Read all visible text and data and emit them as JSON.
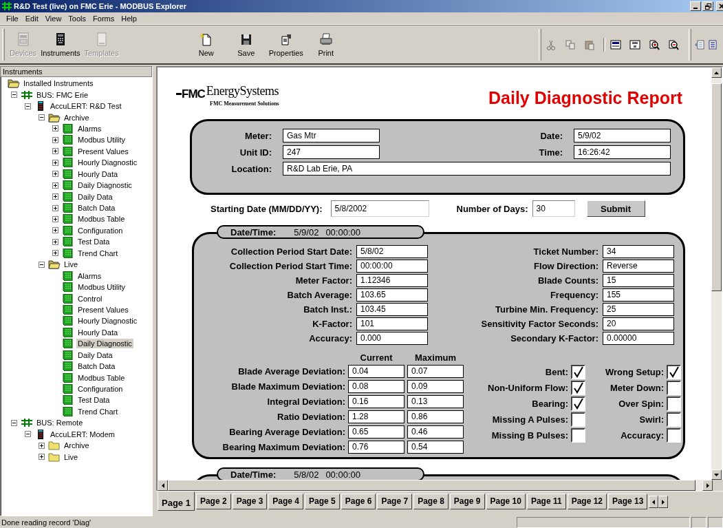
{
  "window": {
    "title": "R&D Test (live) on FMC Erie - MODBUS Explorer"
  },
  "menu": [
    "File",
    "Edit",
    "View",
    "Tools",
    "Forms",
    "Help"
  ],
  "toolbar": {
    "panes": [
      {
        "label": "Devices",
        "disabled": true
      },
      {
        "label": "Instruments",
        "disabled": false
      },
      {
        "label": "Templates",
        "disabled": true
      }
    ],
    "actions": [
      {
        "label": "New"
      },
      {
        "label": "Save"
      },
      {
        "label": "Properties"
      },
      {
        "label": "Print"
      }
    ],
    "edit_tools": [
      {
        "disabled": true
      },
      {
        "disabled": true
      },
      {
        "disabled": true
      },
      {
        "disabled": false
      },
      {
        "disabled": false
      },
      {
        "disabled": false
      },
      {
        "disabled": false
      }
    ]
  },
  "sidebar": {
    "title": "Instruments",
    "tree": [
      {
        "label": "Installed Instruments",
        "kind": "folder",
        "expanded": true,
        "selected": false,
        "children": [
          {
            "label": "BUS: FMC Erie",
            "kind": "bus",
            "expanded": true,
            "selected": false,
            "children": [
              {
                "label": "AccuLERT: R&D Test",
                "kind": "device",
                "expanded": true,
                "selected": false,
                "children": [
                  {
                    "label": "Archive",
                    "kind": "folder",
                    "expanded": true,
                    "selected": false,
                    "children": [
                      {
                        "label": "Alarms",
                        "kind": "form",
                        "expanded": false,
                        "selected": false
                      },
                      {
                        "label": "Modbus Utility",
                        "kind": "form",
                        "expanded": false,
                        "selected": false
                      },
                      {
                        "label": "Present Values",
                        "kind": "form",
                        "expanded": false,
                        "selected": false
                      },
                      {
                        "label": "Hourly Diagnostic",
                        "kind": "form",
                        "expanded": false,
                        "selected": false
                      },
                      {
                        "label": "Hourly Data",
                        "kind": "form",
                        "expanded": false,
                        "selected": false
                      },
                      {
                        "label": "Daily Diagnostic",
                        "kind": "form",
                        "expanded": false,
                        "selected": false
                      },
                      {
                        "label": "Daily Data",
                        "kind": "form",
                        "expanded": false,
                        "selected": false
                      },
                      {
                        "label": "Batch Data",
                        "kind": "form",
                        "expanded": false,
                        "selected": false
                      },
                      {
                        "label": "Modbus Table",
                        "kind": "form",
                        "expanded": false,
                        "selected": false
                      },
                      {
                        "label": "Configuration",
                        "kind": "form",
                        "expanded": false,
                        "selected": false
                      },
                      {
                        "label": "Test Data",
                        "kind": "form",
                        "expanded": false,
                        "selected": false
                      },
                      {
                        "label": "Trend Chart",
                        "kind": "form",
                        "expanded": false,
                        "selected": false
                      }
                    ]
                  },
                  {
                    "label": "Live",
                    "kind": "folder",
                    "expanded": true,
                    "selected": false,
                    "children": [
                      {
                        "label": "Alarms",
                        "kind": "form",
                        "selected": false
                      },
                      {
                        "label": "Modbus Utility",
                        "kind": "form",
                        "selected": false
                      },
                      {
                        "label": "Control",
                        "kind": "form",
                        "selected": false
                      },
                      {
                        "label": "Present Values",
                        "kind": "form",
                        "selected": false
                      },
                      {
                        "label": "Hourly Diagnostic",
                        "kind": "form",
                        "selected": false
                      },
                      {
                        "label": "Hourly Data",
                        "kind": "form",
                        "selected": false
                      },
                      {
                        "label": "Daily Diagnostic",
                        "kind": "form",
                        "selected": true
                      },
                      {
                        "label": "Daily Data",
                        "kind": "form",
                        "selected": false
                      },
                      {
                        "label": "Batch Data",
                        "kind": "form",
                        "selected": false
                      },
                      {
                        "label": "Modbus Table",
                        "kind": "form",
                        "selected": false
                      },
                      {
                        "label": "Configuration",
                        "kind": "form",
                        "selected": false
                      },
                      {
                        "label": "Test Data",
                        "kind": "form",
                        "selected": false
                      },
                      {
                        "label": "Trend Chart",
                        "kind": "form",
                        "selected": false
                      }
                    ]
                  }
                ]
              }
            ]
          },
          {
            "label": "BUS: Remote",
            "kind": "bus",
            "expanded": true,
            "selected": false,
            "children": [
              {
                "label": "AccuLERT: Modem",
                "kind": "device",
                "expanded": true,
                "selected": false,
                "children": [
                  {
                    "label": "Archive",
                    "kind": "folder",
                    "expanded": false,
                    "selected": false
                  },
                  {
                    "label": "Live",
                    "kind": "folder",
                    "expanded": false,
                    "selected": false
                  }
                ]
              }
            ]
          }
        ]
      }
    ]
  },
  "report": {
    "logo": {
      "brand": "FMC",
      "name": "EnergySystems",
      "sub": "FMC Measurement Solutions"
    },
    "title": "Daily Diagnostic Report",
    "info": [
      {
        "label": "Meter:",
        "value": "Gas Mtr",
        "kind": "short"
      },
      {
        "label": "Date:",
        "value": "5/9/02",
        "kind": "short"
      },
      {
        "label": "Unit ID:",
        "value": "247",
        "kind": "short"
      },
      {
        "label": "Time:",
        "value": "16:26:42",
        "kind": "short"
      },
      {
        "label": "Location:",
        "value": "R&D Lab Erie, PA",
        "kind": "wide"
      }
    ],
    "query": {
      "start_label": "Starting Date (MM/DD/YY):",
      "start_value": "5/8/2002",
      "days_label": "Number of Days:",
      "days_value": "30",
      "submit": "Submit"
    },
    "records": [
      {
        "date_label": "Date/Time:",
        "date": "5/9/02",
        "time": "00:00:00",
        "fields_left": [
          {
            "label": "Collection Period Start Date:",
            "value": "5/8/02"
          },
          {
            "label": "Collection Period Start Time:",
            "value": "00:00:00"
          },
          {
            "label": "Meter Factor:",
            "value": "1.12346"
          },
          {
            "label": "Batch Average:",
            "value": "103.65"
          },
          {
            "label": "Batch Inst.:",
            "value": "103.45"
          },
          {
            "label": "K-Factor:",
            "value": "101"
          },
          {
            "label": "Accuracy:",
            "value": "0.000"
          }
        ],
        "fields_right": [
          {
            "label": "Ticket Number:",
            "value": "34"
          },
          {
            "label": "Flow Direction:",
            "value": "Reverse"
          },
          {
            "label": "Blade Counts:",
            "value": "15"
          },
          {
            "label": "Frequency:",
            "value": "155"
          },
          {
            "label": "Turbine Min. Frequency:",
            "value": "25"
          },
          {
            "label": "Sensitivity Factor Seconds:",
            "value": "20"
          },
          {
            "label": "Secondary K-Factor:",
            "value": "0.00000"
          }
        ],
        "deviation_headers": [
          "Current",
          "Maximum"
        ],
        "deviations": [
          {
            "label": "Blade Average Deviation:",
            "current": "0.04",
            "maximum": "0.07"
          },
          {
            "label": "Blade Maximum Deviation:",
            "current": "0.08",
            "maximum": "0.09"
          },
          {
            "label": "Integral Deviation:",
            "current": "0.16",
            "maximum": "0.13"
          },
          {
            "label": "Ratio Deviation:",
            "current": "1.28",
            "maximum": "0.86"
          },
          {
            "label": "Bearing Average Deviation:",
            "current": "0.65",
            "maximum": "0.46"
          },
          {
            "label": "Bearing Maximum Deviation:",
            "current": "0.76",
            "maximum": "0.54"
          }
        ],
        "flags": [
          {
            "label": "Bent:",
            "checked": true
          },
          {
            "label": "Wrong Setup:",
            "checked": true
          },
          {
            "label": "Non-Uniform Flow:",
            "checked": true
          },
          {
            "label": "Meter Down:",
            "checked": false
          },
          {
            "label": "Bearing:",
            "checked": true
          },
          {
            "label": "Over Spin:",
            "checked": false
          },
          {
            "label": "Missing A Pulses:",
            "checked": false
          },
          {
            "label": "Swirl:",
            "checked": false
          },
          {
            "label": "Missing B Pulses:",
            "checked": false
          },
          {
            "label": "Accuracy:",
            "checked": false
          }
        ]
      },
      {
        "date_label": "Date/Time:",
        "date": "5/8/02",
        "time": "00:00:00"
      }
    ]
  },
  "tabs": [
    {
      "label": "Page 1",
      "selected": true
    },
    {
      "label": "Page 2",
      "selected": false
    },
    {
      "label": "Page 3",
      "selected": false
    },
    {
      "label": "Page 4",
      "selected": false
    },
    {
      "label": "Page 5",
      "selected": false
    },
    {
      "label": "Page 6",
      "selected": false
    },
    {
      "label": "Page 7",
      "selected": false
    },
    {
      "label": "Page 8",
      "selected": false
    },
    {
      "label": "Page 9",
      "selected": false
    },
    {
      "label": "Page 10",
      "selected": false
    },
    {
      "label": "Page 11",
      "selected": false
    },
    {
      "label": "Page 12",
      "selected": false
    },
    {
      "label": "Page 13",
      "selected": false
    }
  ],
  "status_bar": {
    "text": "Done reading record 'Diag'"
  }
}
